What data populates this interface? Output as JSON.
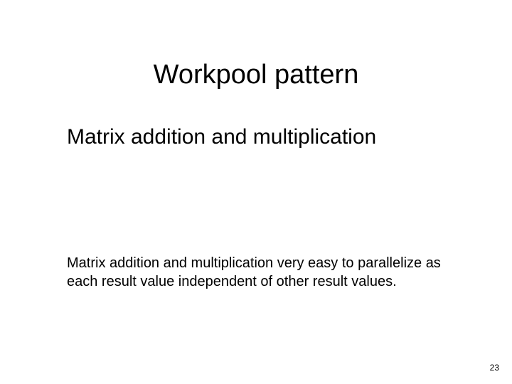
{
  "slide": {
    "title": "Workpool pattern",
    "subtitle": "Matrix addition and multiplication",
    "body": "Matrix addition and multiplication very easy to parallelize as each result value independent of other result values.",
    "page_number": "23"
  }
}
